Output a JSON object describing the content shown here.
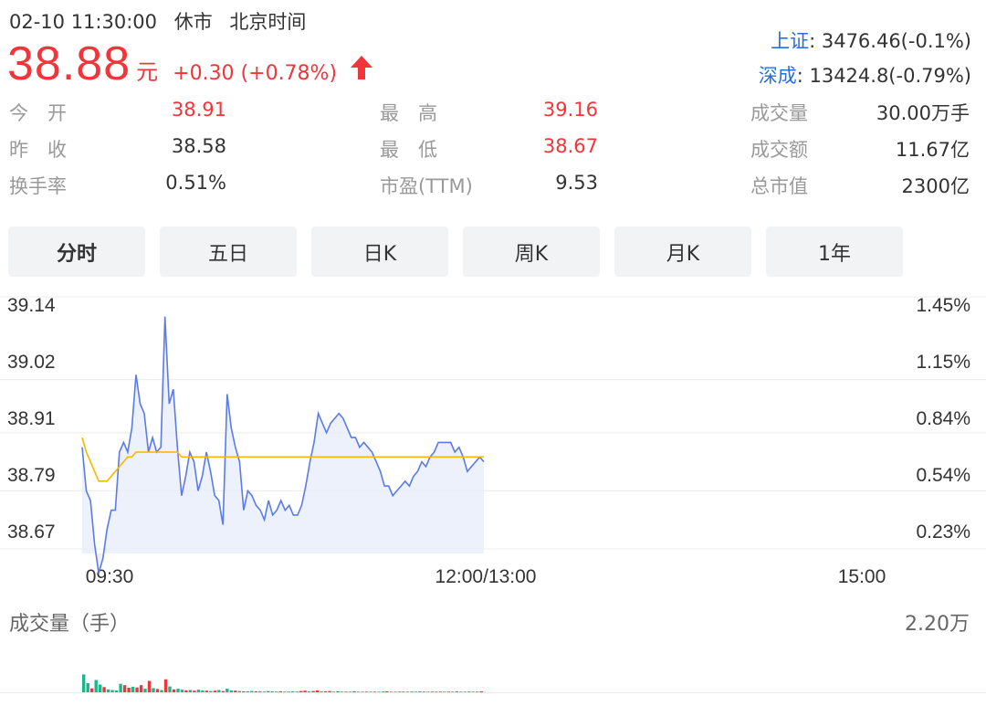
{
  "header": {
    "datetime": "02-10 11:30:00",
    "status": "休市",
    "timezone": "北京时间",
    "price": "38.88",
    "unit": "元",
    "change": "+0.30 (+0.78%)",
    "direction_icon": "arrow-up-icon",
    "up_color": "#f2353a"
  },
  "indices": [
    {
      "name": "上证",
      "value": ": 3476.46(-0.1%)"
    },
    {
      "name": "深成",
      "value": ": 13424.8(-0.79%)"
    }
  ],
  "stats": [
    [
      {
        "label": "今　开",
        "value": "38.91",
        "color": "red"
      },
      {
        "label": "最　高",
        "value": "39.16",
        "color": "red"
      },
      {
        "label": "成交量",
        "value": "30.00万手",
        "color": ""
      }
    ],
    [
      {
        "label": "昨　收",
        "value": "38.58",
        "color": ""
      },
      {
        "label": "最　低",
        "value": "38.67",
        "color": "red"
      },
      {
        "label": "成交额",
        "value": "11.67亿",
        "color": ""
      }
    ],
    [
      {
        "label": "换手率",
        "value": "0.51%",
        "color": ""
      },
      {
        "label": "市盈(TTM)",
        "value": "9.53",
        "color": ""
      },
      {
        "label": "总市值",
        "value": "2300亿",
        "color": ""
      }
    ]
  ],
  "tabs": [
    "分时",
    "五日",
    "日K",
    "周K",
    "月K",
    "1年"
  ],
  "active_tab": "分时",
  "chart_data": {
    "type": "line",
    "y_left_ticks": [
      "39.14",
      "39.02",
      "38.91",
      "38.79",
      "38.67"
    ],
    "y_right_ticks": [
      "1.45%",
      "1.15%",
      "0.84%",
      "0.54%",
      "0.23%"
    ],
    "x_ticks": [
      "09:30",
      "12:00/13:00",
      "15:00"
    ],
    "ylim": [
      38.67,
      39.14
    ],
    "colors": {
      "price": "#5b7be6",
      "average": "#f5b800",
      "fill": "#e9edfb"
    },
    "series": [
      {
        "role": "price",
        "values": [
          38.88,
          38.79,
          38.77,
          38.68,
          38.62,
          38.65,
          38.71,
          38.75,
          38.75,
          38.87,
          38.89,
          38.87,
          38.92,
          39.03,
          38.97,
          38.95,
          38.87,
          38.9,
          38.87,
          38.88,
          39.15,
          38.97,
          39.0,
          38.88,
          38.78,
          38.82,
          38.87,
          38.85,
          38.79,
          38.82,
          38.87,
          38.83,
          38.78,
          38.77,
          38.72,
          38.99,
          38.92,
          38.88,
          38.85,
          38.75,
          38.79,
          38.78,
          38.76,
          38.75,
          38.73,
          38.77,
          38.74,
          38.75,
          38.77,
          38.75,
          38.76,
          38.74,
          38.74,
          38.76,
          38.8,
          38.85,
          38.89,
          38.95,
          38.93,
          38.91,
          38.93,
          38.94,
          38.95,
          38.94,
          38.92,
          38.9,
          38.9,
          38.88,
          38.89,
          38.88,
          38.87,
          38.85,
          38.83,
          38.8,
          38.8,
          38.78,
          38.79,
          38.8,
          38.81,
          38.8,
          38.82,
          38.83,
          38.85,
          38.84,
          38.86,
          38.87,
          38.89,
          38.89,
          38.89,
          38.89,
          38.87,
          38.88,
          38.86,
          38.83,
          38.84,
          38.85,
          38.86,
          38.85
        ],
        "average": [
          38.9,
          38.87,
          38.85,
          38.83,
          38.81,
          38.81,
          38.81,
          38.82,
          38.83,
          38.84,
          38.85,
          38.86,
          38.86,
          38.87,
          38.87,
          38.87,
          38.87,
          38.87,
          38.87,
          38.87,
          38.87,
          38.87,
          38.87,
          38.87,
          38.86,
          38.86,
          38.86,
          38.86,
          38.86,
          38.86,
          38.86,
          38.86,
          38.86,
          38.86,
          38.86,
          38.86,
          38.86,
          38.86,
          38.86,
          38.86,
          38.86,
          38.86,
          38.86,
          38.86,
          38.86,
          38.86,
          38.86,
          38.86,
          38.86,
          38.86,
          38.86,
          38.86,
          38.86,
          38.86,
          38.86,
          38.86,
          38.86,
          38.86,
          38.86,
          38.86,
          38.86,
          38.86,
          38.86,
          38.86,
          38.86,
          38.86,
          38.86,
          38.86,
          38.86,
          38.86,
          38.86,
          38.86,
          38.86,
          38.86,
          38.86,
          38.86,
          38.86,
          38.86,
          38.86,
          38.86,
          38.86,
          38.86,
          38.86,
          38.86,
          38.86,
          38.86,
          38.86,
          38.86,
          38.86,
          38.86,
          38.86,
          38.86,
          38.86,
          38.86,
          38.86,
          38.86,
          38.86,
          38.86
        ]
      }
    ]
  },
  "volume": {
    "title": "成交量（手）",
    "max_label": "2.20万",
    "ylim": [
      0,
      22000
    ],
    "colors": {
      "up": "#f2353a",
      "down": "#1fb489"
    },
    "bars": [
      {
        "v": 5500,
        "d": "down"
      },
      {
        "v": 2800,
        "d": "down"
      },
      {
        "v": 1200,
        "d": "up"
      },
      {
        "v": 3800,
        "d": "down"
      },
      {
        "v": 2400,
        "d": "down"
      },
      {
        "v": 1600,
        "d": "up"
      },
      {
        "v": 900,
        "d": "down"
      },
      {
        "v": 700,
        "d": "down"
      },
      {
        "v": 600,
        "d": "down"
      },
      {
        "v": 2600,
        "d": "down"
      },
      {
        "v": 2200,
        "d": "up"
      },
      {
        "v": 1400,
        "d": "up"
      },
      {
        "v": 1700,
        "d": "down"
      },
      {
        "v": 1500,
        "d": "up"
      },
      {
        "v": 2200,
        "d": "up"
      },
      {
        "v": 1100,
        "d": "down"
      },
      {
        "v": 3500,
        "d": "up"
      },
      {
        "v": 1300,
        "d": "down"
      },
      {
        "v": 1000,
        "d": "up"
      },
      {
        "v": 700,
        "d": "down"
      },
      {
        "v": 4000,
        "d": "up"
      },
      {
        "v": 1800,
        "d": "down"
      },
      {
        "v": 900,
        "d": "up"
      },
      {
        "v": 1100,
        "d": "down"
      },
      {
        "v": 800,
        "d": "down"
      },
      {
        "v": 600,
        "d": "up"
      },
      {
        "v": 700,
        "d": "down"
      },
      {
        "v": 500,
        "d": "up"
      },
      {
        "v": 800,
        "d": "down"
      },
      {
        "v": 600,
        "d": "down"
      },
      {
        "v": 500,
        "d": "up"
      },
      {
        "v": 400,
        "d": "down"
      },
      {
        "v": 500,
        "d": "up"
      },
      {
        "v": 700,
        "d": "down"
      },
      {
        "v": 400,
        "d": "up"
      },
      {
        "v": 1100,
        "d": "down"
      },
      {
        "v": 600,
        "d": "down"
      },
      {
        "v": 500,
        "d": "up"
      },
      {
        "v": 400,
        "d": "down"
      },
      {
        "v": 300,
        "d": "up"
      },
      {
        "v": 300,
        "d": "down"
      },
      {
        "v": 400,
        "d": "down"
      },
      {
        "v": 300,
        "d": "up"
      },
      {
        "v": 300,
        "d": "down"
      },
      {
        "v": 200,
        "d": "up"
      },
      {
        "v": 400,
        "d": "down"
      },
      {
        "v": 300,
        "d": "down"
      },
      {
        "v": 200,
        "d": "up"
      },
      {
        "v": 300,
        "d": "up"
      },
      {
        "v": 200,
        "d": "down"
      },
      {
        "v": 200,
        "d": "up"
      },
      {
        "v": 300,
        "d": "down"
      },
      {
        "v": 200,
        "d": "up"
      },
      {
        "v": 400,
        "d": "up"
      },
      {
        "v": 500,
        "d": "up"
      },
      {
        "v": 300,
        "d": "down"
      },
      {
        "v": 400,
        "d": "up"
      },
      {
        "v": 600,
        "d": "up"
      },
      {
        "v": 300,
        "d": "down"
      },
      {
        "v": 300,
        "d": "up"
      },
      {
        "v": 400,
        "d": "up"
      },
      {
        "v": 200,
        "d": "down"
      },
      {
        "v": 300,
        "d": "up"
      },
      {
        "v": 200,
        "d": "down"
      },
      {
        "v": 200,
        "d": "up"
      },
      {
        "v": 200,
        "d": "down"
      },
      {
        "v": 300,
        "d": "up"
      },
      {
        "v": 200,
        "d": "down"
      },
      {
        "v": 200,
        "d": "down"
      },
      {
        "v": 200,
        "d": "up"
      },
      {
        "v": 200,
        "d": "down"
      },
      {
        "v": 200,
        "d": "up"
      },
      {
        "v": 200,
        "d": "down"
      },
      {
        "v": 200,
        "d": "up"
      },
      {
        "v": 300,
        "d": "up"
      },
      {
        "v": 200,
        "d": "down"
      },
      {
        "v": 200,
        "d": "down"
      },
      {
        "v": 200,
        "d": "up"
      },
      {
        "v": 200,
        "d": "up"
      },
      {
        "v": 200,
        "d": "down"
      },
      {
        "v": 200,
        "d": "up"
      },
      {
        "v": 200,
        "d": "down"
      },
      {
        "v": 300,
        "d": "down"
      },
      {
        "v": 200,
        "d": "up"
      },
      {
        "v": 200,
        "d": "down"
      },
      {
        "v": 200,
        "d": "up"
      },
      {
        "v": 200,
        "d": "down"
      },
      {
        "v": 200,
        "d": "up"
      },
      {
        "v": 200,
        "d": "down"
      },
      {
        "v": 200,
        "d": "up"
      },
      {
        "v": 200,
        "d": "down"
      },
      {
        "v": 300,
        "d": "down"
      },
      {
        "v": 200,
        "d": "down"
      },
      {
        "v": 200,
        "d": "down"
      },
      {
        "v": 200,
        "d": "up"
      },
      {
        "v": 200,
        "d": "down"
      },
      {
        "v": 200,
        "d": "up"
      },
      {
        "v": 300,
        "d": "up"
      }
    ]
  }
}
